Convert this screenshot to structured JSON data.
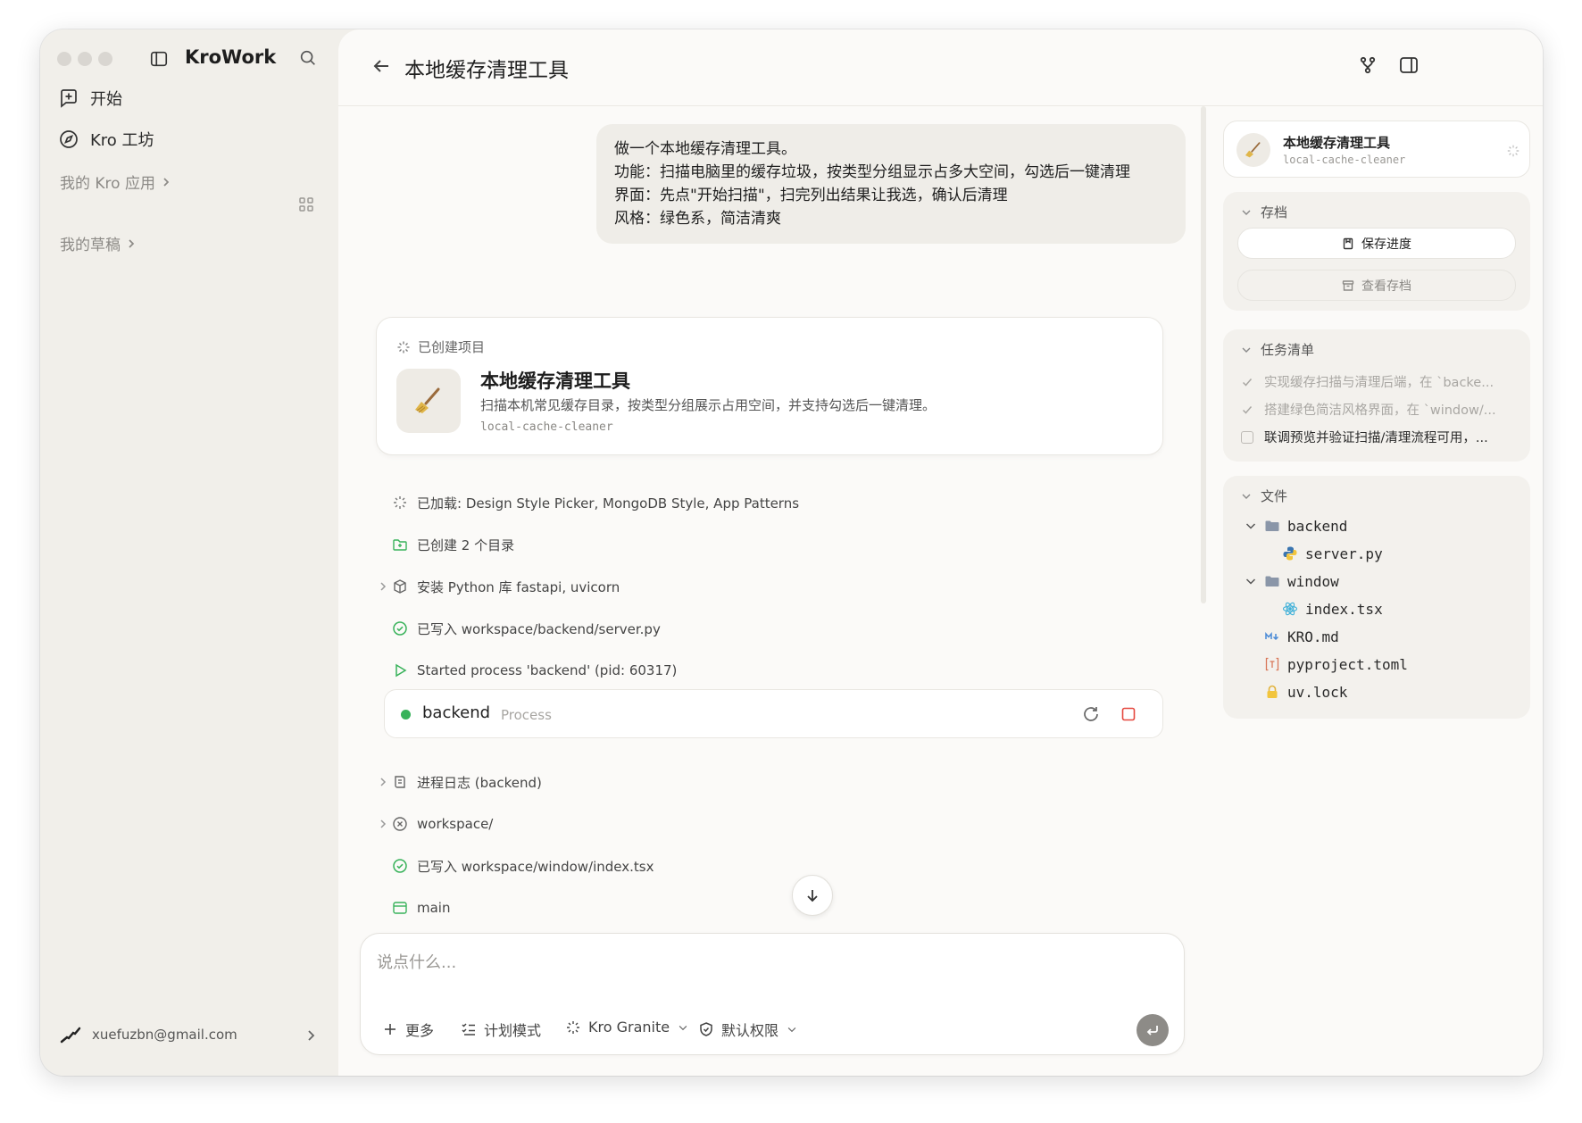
{
  "app": {
    "name": "KroWork"
  },
  "sidebar": {
    "items": [
      {
        "label": "开始"
      },
      {
        "label": "Kro 工坊"
      }
    ],
    "my_apps_label": "我的 Kro 应用",
    "drafts_label": "我的草稿",
    "user_email": "xuefuzbn@gmail.com"
  },
  "header": {
    "title": "本地缓存清理工具"
  },
  "chat": {
    "user_message": [
      "做一个本地缓存清理工具。",
      "功能：扫描电脑里的缓存垃圾，按类型分组显示占多大空间，勾选后一键清理",
      "界面：先点\"开始扫描\"，扫完列出结果让我选，确认后清理",
      "风格：绿色系，简洁清爽"
    ],
    "project_card": {
      "header": "已创建项目",
      "title": "本地缓存清理工具",
      "description": "扫描本机常见缓存目录，按类型分组展示占用空间，并支持勾选后一键清理。",
      "slug": "local-cache-cleaner"
    },
    "steps": [
      {
        "icon": "sparkle-icon",
        "text": "已加载: Design Style Picker, MongoDB Style, App Patterns"
      },
      {
        "icon": "folder-plus-icon",
        "text": "已创建 2 个目录"
      },
      {
        "icon": "package-icon",
        "text": "安装 Python 库 fastapi, uvicorn"
      },
      {
        "icon": "check-circle-icon",
        "text": "已写入 workspace/backend/server.py"
      },
      {
        "icon": "play-icon",
        "text": "Started process 'backend' (pid: 60317)"
      }
    ],
    "process": {
      "name": "backend",
      "type": "Process",
      "status_color": "#38b25a"
    },
    "steps2": [
      {
        "icon": "log-icon",
        "text": "进程日志 (backend)"
      },
      {
        "icon": "x-circle-icon",
        "text": "workspace/"
      },
      {
        "icon": "check-circle-icon",
        "text": "已写入 workspace/window/index.tsx"
      },
      {
        "icon": "window-icon",
        "text": "main"
      }
    ]
  },
  "composer": {
    "placeholder": "说点什么...",
    "more": "更多",
    "plan_mode": "计划模式",
    "model": "Kro Granite",
    "permission": "默认权限"
  },
  "right_panel": {
    "project": {
      "title": "本地缓存清理工具",
      "slug": "local-cache-cleaner"
    },
    "archive": {
      "label": "存档",
      "save_button": "保存进度",
      "view_button": "查看存档"
    },
    "tasks": {
      "label": "任务清单",
      "items": [
        {
          "text": "实现缓存扫描与清理后端，在 `backe...",
          "done": true
        },
        {
          "text": "搭建绿色简洁风格界面，在 `window/...",
          "done": true
        },
        {
          "text": "联调预览并验证扫描/清理流程可用，...",
          "done": false
        }
      ]
    },
    "files": {
      "label": "文件",
      "tree": [
        {
          "name": "backend",
          "type": "folder"
        },
        {
          "name": "server.py",
          "type": "python"
        },
        {
          "name": "window",
          "type": "folder"
        },
        {
          "name": "index.tsx",
          "type": "react"
        },
        {
          "name": "KRO.md",
          "type": "markdown"
        },
        {
          "name": "pyproject.toml",
          "type": "toml"
        },
        {
          "name": "uv.lock",
          "type": "lock"
        }
      ]
    }
  },
  "colors": {
    "accent_green": "#38b25a",
    "stop_red": "#e5483f"
  }
}
